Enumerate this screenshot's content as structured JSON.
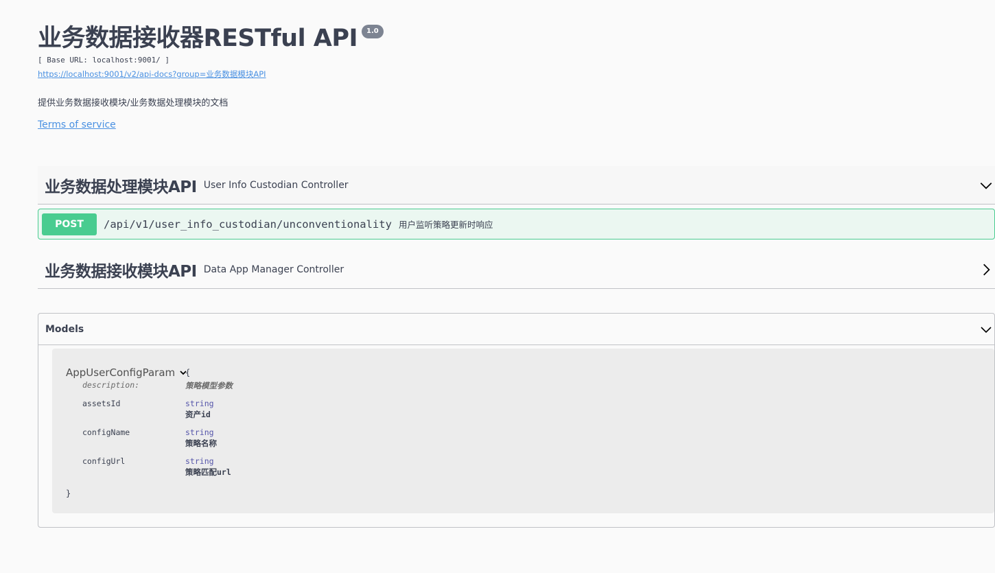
{
  "info": {
    "title": "业务数据接收器RESTful API",
    "version": "1.0",
    "base_url": "[ Base URL: localhost:9001/ ]",
    "api_docs_link": "https://localhost:9001/v2/api-docs?group=业务数据模块API",
    "description": "提供业务数据接收模块/业务数据处理模块的文档",
    "terms_of_service": "Terms of service"
  },
  "tags": [
    {
      "name": "业务数据处理模块API",
      "description": "User Info Custodian Controller",
      "expanded": true,
      "chevron_icon": "chevron-down-icon"
    },
    {
      "name": "业务数据接收模块API",
      "description": "Data App Manager Controller",
      "expanded": false,
      "chevron_icon": "chevron-right-icon"
    }
  ],
  "operation": {
    "method": "POST",
    "path": "/api/v1/user_info_custodian/unconventionality",
    "summary": "用户监听策略更新时响应"
  },
  "models": {
    "title": "Models",
    "chevron_icon": "chevron-down-icon",
    "model": {
      "name": "AppUserConfigParam",
      "brace_open": "{",
      "brace_close": "}",
      "description_label": "description:",
      "description": "策略模型参数",
      "properties": [
        {
          "name": "assetsId",
          "type": "string",
          "description": "资产id"
        },
        {
          "name": "configName",
          "type": "string",
          "description": "策略名称"
        },
        {
          "name": "configUrl",
          "type": "string",
          "description": "策略匹配url"
        }
      ]
    }
  },
  "colors": {
    "background": "#fafafa",
    "text": "#3b4151",
    "link": "#4990e2",
    "post_accent": "#49cc90",
    "post_background": "#ebf7f1",
    "version_badge": "#7d8492"
  }
}
